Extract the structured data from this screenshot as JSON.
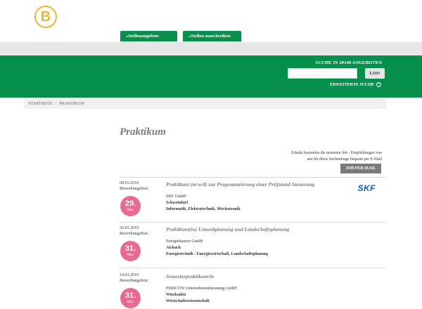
{
  "brand": {
    "logo_letter": "B",
    "logo_color": "#f1b434"
  },
  "colors": {
    "primary_green": "#07904b",
    "badge_pink": "#e96a8f",
    "title_gray": "#7a7a7a"
  },
  "nav": {
    "tabs": [
      {
        "label": "»Stellenangebote"
      },
      {
        "label": "»Stellen ausschreiben"
      }
    ]
  },
  "search": {
    "title": "SUCHE IN 28148 ANGEBOTEN",
    "input_value": "",
    "button_label": "LOS!",
    "advanced_label": "ERWEITERTE SUCHE",
    "advanced_icon": "plus-circle-icon"
  },
  "breadcrumb": {
    "home": "STARTSEITE",
    "separator": "/",
    "current": "PRAKTIKUM"
  },
  "page": {
    "title": "Praktikum"
  },
  "mail": {
    "line1": "Erhalte kostenlos die neuesten Job - Empfehlungen von",
    "line2": "uns für diese Suchanfrage bequem per E-Mail",
    "button_label": "JOB PER MAIL"
  },
  "jobs": [
    {
      "date": "08.03.2019",
      "deadline_label": "Bewerbungsfrist:",
      "deadline_day": "29.",
      "deadline_month": "Mar.",
      "title": "Praktikant (m/w/d) zur Programmierung einer Prüfstand-Steuerung",
      "company": "SKF GmbH",
      "city": "Schweinfurt",
      "field": "Informatik, Elektrotechnik, Mechatronik",
      "logo_text": "SKF"
    },
    {
      "date": "20.03.2019",
      "deadline_label": "Bewerbungsfrist:",
      "deadline_day": "31.",
      "deadline_month": "Mar.",
      "title": "Praktikant(in) Umweltplanung und Landschaftsplanung",
      "company": "Energiebauern GmbH",
      "city": "Aichach",
      "field": "Energietechnik / Energiewirtschaft, Landschaftsplanung"
    },
    {
      "date": "14.03.2019",
      "deadline_label": "Bewerbungsfrist:",
      "deadline_day": "31.",
      "deadline_month": "Mar.",
      "title": "Semesterpraktikant/in",
      "company": "PERICON Unternehmensberatung GmbH",
      "city": "Wiesbaden",
      "field": "Wirtschaftswissenschaft"
    }
  ]
}
